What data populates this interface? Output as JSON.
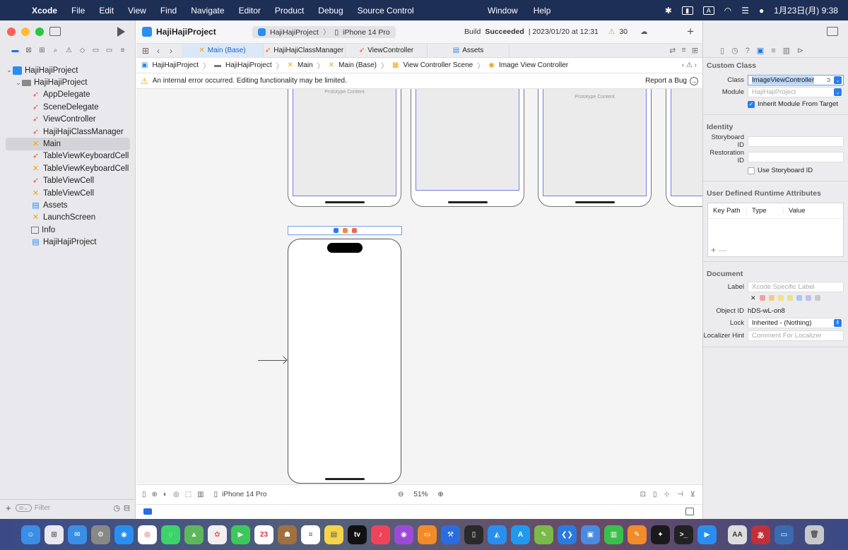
{
  "menubar": {
    "app_name": "Xcode",
    "menus": [
      "File",
      "Edit",
      "View",
      "Find",
      "Navigate",
      "Editor",
      "Product",
      "Debug",
      "Source Control"
    ],
    "center_menus": [
      "Window",
      "Help"
    ],
    "input_mode": "A",
    "clock": "1月23日(月) 9:38"
  },
  "navigator": {
    "tree": [
      {
        "label": "HajiHajiProject",
        "icon": "project-icon",
        "depth": 0,
        "kind": "proj"
      },
      {
        "label": "HajiHajiProject",
        "icon": "folder-icon",
        "depth": 1,
        "kind": "folder"
      },
      {
        "label": "AppDelegate",
        "icon": "swift-file-icon",
        "depth": 2,
        "kind": "swift"
      },
      {
        "label": "SceneDelegate",
        "icon": "swift-file-icon",
        "depth": 2,
        "kind": "swift"
      },
      {
        "label": "ViewController",
        "icon": "swift-file-icon",
        "depth": 2,
        "kind": "swift"
      },
      {
        "label": "HajiHajiClassManager",
        "icon": "swift-file-icon",
        "depth": 2,
        "kind": "swift"
      },
      {
        "label": "Main",
        "icon": "storyboard-icon",
        "depth": 2,
        "kind": "ib",
        "selected": true
      },
      {
        "label": "TableViewKeyboardCell",
        "icon": "swift-file-icon",
        "depth": 2,
        "kind": "swift"
      },
      {
        "label": "TableViewKeyboardCell",
        "icon": "xib-icon",
        "depth": 2,
        "kind": "ib"
      },
      {
        "label": "TableViewCell",
        "icon": "swift-file-icon",
        "depth": 2,
        "kind": "swift"
      },
      {
        "label": "TableViewCell",
        "icon": "xib-icon",
        "depth": 2,
        "kind": "ib"
      },
      {
        "label": "Assets",
        "icon": "asset-catalog-icon",
        "depth": 2,
        "kind": "asset"
      },
      {
        "label": "LaunchScreen",
        "icon": "storyboard-icon",
        "depth": 2,
        "kind": "ib"
      },
      {
        "label": "Info",
        "icon": "plist-icon",
        "depth": 2,
        "kind": "plist"
      },
      {
        "label": "HajiHajiProject",
        "icon": "test-target-icon",
        "depth": 2,
        "kind": "asset"
      }
    ],
    "filter_placeholder": "Filter"
  },
  "toolbar": {
    "project_title": "HajiHajiProject",
    "scheme": "HajiHajiProject",
    "device": "iPhone 14 Pro",
    "build_prefix": "Build",
    "build_status": "Succeeded",
    "build_time": "| 2023/01/20 at 12:31",
    "warning_count": "30"
  },
  "tabs": [
    {
      "label": "Main (Base)",
      "icon": "storyboard-icon",
      "active": true
    },
    {
      "label": "HajiHajiClassManager",
      "icon": "swift-file-icon",
      "active": false
    },
    {
      "label": "ViewController",
      "icon": "swift-file-icon",
      "active": false
    },
    {
      "label": "Assets",
      "icon": "asset-catalog-icon",
      "active": false
    }
  ],
  "jumpbar": [
    "HajiHajiProject",
    "HajiHajiProject",
    "Main",
    "Main (Base)",
    "View Controller Scene",
    "Image View Controller"
  ],
  "warning": {
    "message": "An internal error occurred. Editing functionality may be limited.",
    "report": "Report a Bug"
  },
  "canvas": {
    "prototype_label": "Prototype Content",
    "device": "iPhone 14 Pro",
    "zoom": "51%"
  },
  "inspector": {
    "custom_class_title": "Custom Class",
    "class_label": "Class",
    "class_value": "ImageViewController",
    "module_label": "Module",
    "module_placeholder": "HajiHajiProject",
    "inherit_label": "Inherit Module From Target",
    "identity_title": "Identity",
    "storyboard_id_label": "Storyboard ID",
    "restoration_id_label": "Restoration ID",
    "use_storyboard_id_label": "Use Storyboard ID",
    "udra_title": "User Defined Runtime Attributes",
    "col_key_path": "Key Path",
    "col_type": "Type",
    "col_value": "Value",
    "document_title": "Document",
    "label_label": "Label",
    "label_placeholder": "Xcode Specific Label",
    "object_id_label": "Object ID",
    "object_id_value": "hDS-wL-on8",
    "lock_label": "Lock",
    "lock_value": "Inherited - (Nothing)",
    "localizer_label": "Localizer Hint",
    "localizer_placeholder": "Comment For Localizer"
  },
  "colors": {
    "accent": "#1a73e8",
    "swift": "#f0582b",
    "interface_builder": "#f2a318",
    "menubar": "#1e2f56"
  }
}
